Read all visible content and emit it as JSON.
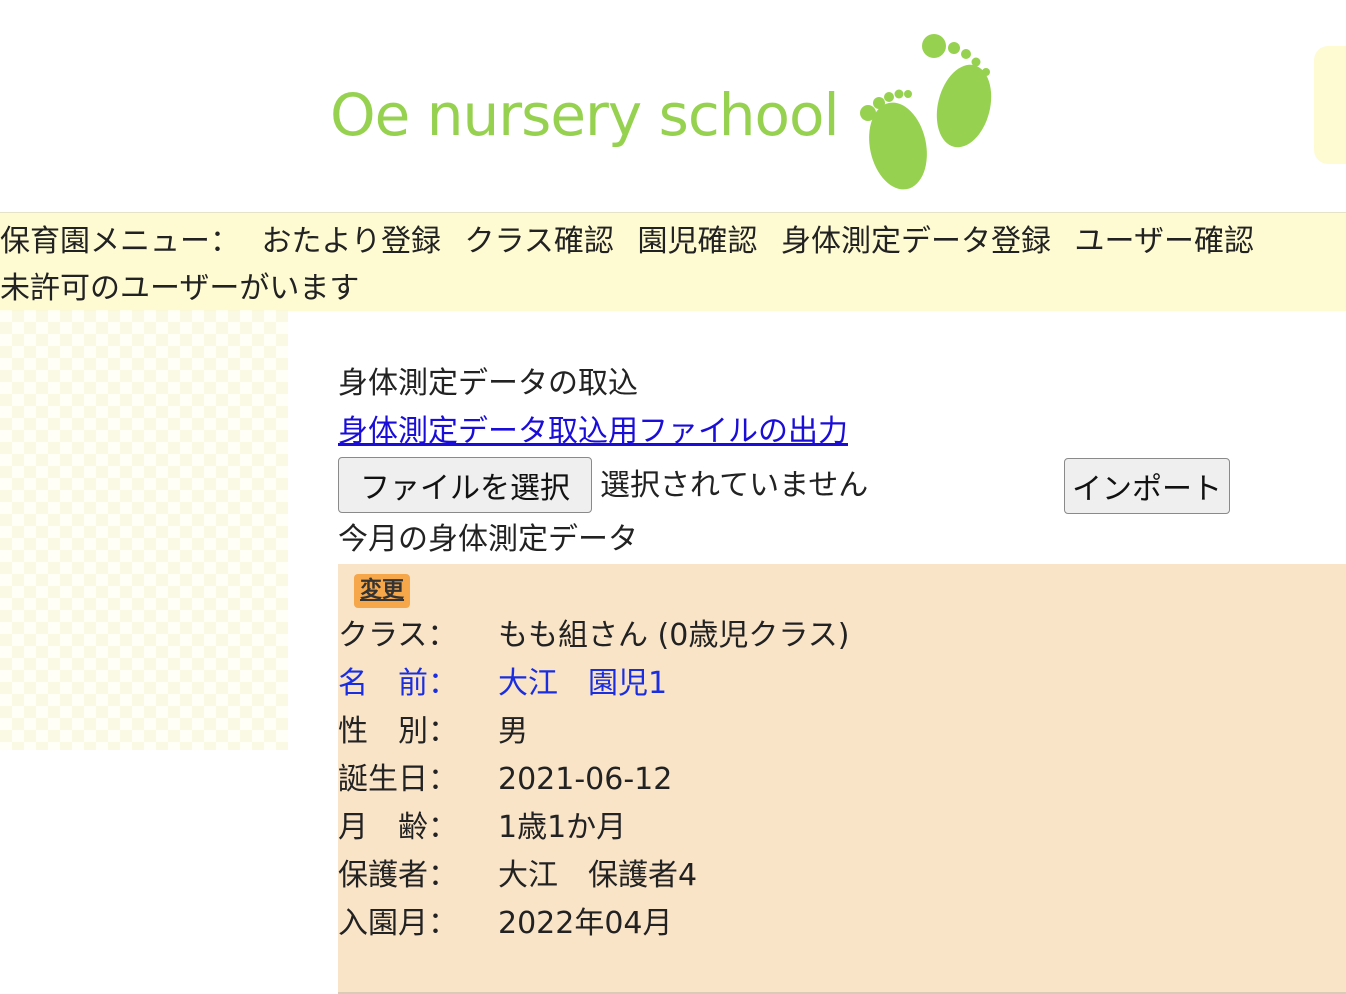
{
  "brand": {
    "logo_text": "Oe nursery school",
    "logo_color": "#96d250"
  },
  "menu": {
    "prefix": "保育園メニュー：",
    "items": [
      "おたより登録",
      "クラス確認",
      "園児確認",
      "身体測定データ登録",
      "ユーザー確認"
    ],
    "notice": "未許可のユーザーがいます"
  },
  "import_section": {
    "title": "身体測定データの取込",
    "export_link": "身体測定データ取込用ファイルの出力",
    "file_button": "ファイルを選択",
    "file_status": "選択されていません",
    "import_button": "インポート"
  },
  "monthly": {
    "title": "今月の身体測定データ",
    "edit_label": "変更",
    "fields": {
      "class": {
        "label": "クラス：",
        "value": "もも組さん (0歳児クラス)"
      },
      "name": {
        "label": "名　前：",
        "value": "大江　園児1"
      },
      "gender": {
        "label": "性　別：",
        "value": "男"
      },
      "birthday": {
        "label": "誕生日：",
        "value": "2021-06-12"
      },
      "age": {
        "label": "月　齢：",
        "value": "1歳1か月"
      },
      "guardian": {
        "label": "保護者：",
        "value": "大江　保護者4"
      },
      "enrolled": {
        "label": "入園月：",
        "value": "2022年04月"
      }
    }
  },
  "colors": {
    "menu_bg": "#fefbd3",
    "card_bg": "#f9e4c8",
    "link": "#1a0dd8",
    "badge": "#f5a74a"
  }
}
